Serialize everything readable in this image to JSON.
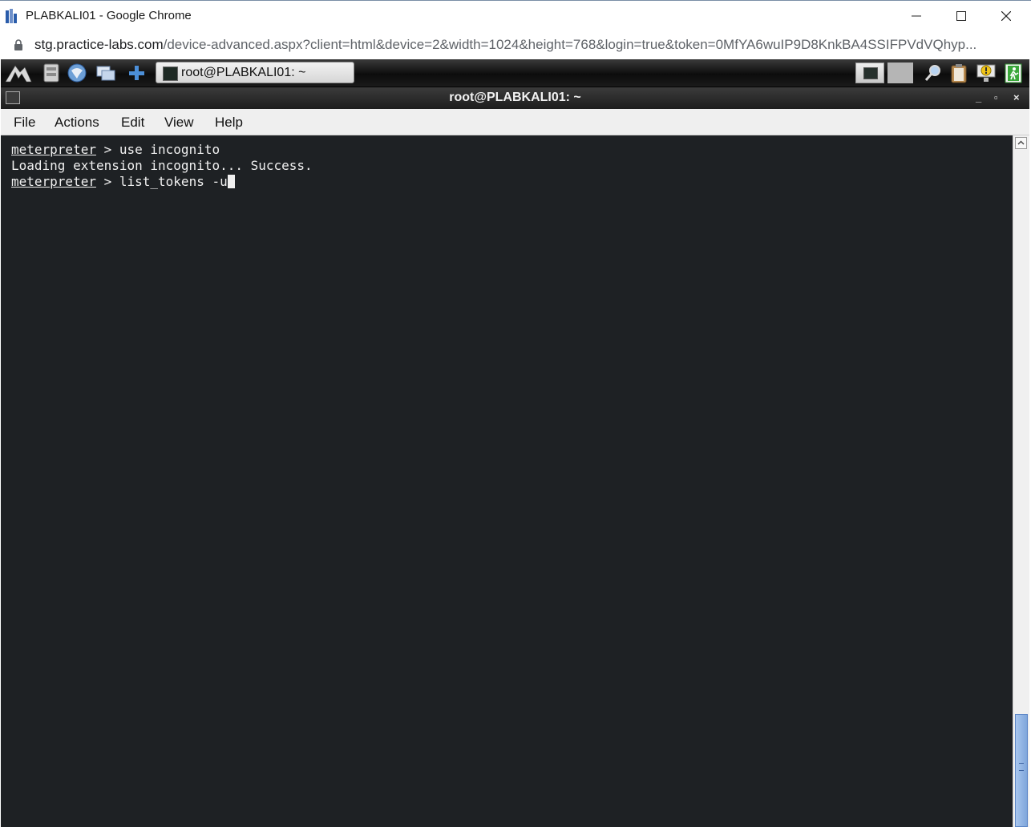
{
  "browser": {
    "title": "PLABKALI01 - Google Chrome",
    "url_domain": "stg.practice-labs.com",
    "url_path": "/device-advanced.aspx?client=html&device=2&width=1024&height=768&login=true&token=0MfYA6wuIP9D8KnkBA4SSIFPVdVQhyp..."
  },
  "panel": {
    "task_button_label": "root@PLABKALI01: ~",
    "icons": [
      "kali-menu-icon",
      "file-manager-icon",
      "browser-icon",
      "show-desktop-icon",
      "add-icon",
      "search-icon",
      "clipboard-icon",
      "notification-icon",
      "logout-icon"
    ]
  },
  "terminal_window": {
    "title": "root@PLABKALI01: ~",
    "controls": [
      "_",
      "▫",
      "×"
    ]
  },
  "menu": {
    "file": "File",
    "actions": "Actions",
    "edit": "Edit",
    "view": "View",
    "help": "Help"
  },
  "terminal": {
    "line1_prompt": "meterpreter",
    "line1_cmd": " > use incognito",
    "line2": "Loading extension incognito... Success.",
    "line3_prompt": "meterpreter",
    "line3_cmd": " > list_tokens -u"
  }
}
